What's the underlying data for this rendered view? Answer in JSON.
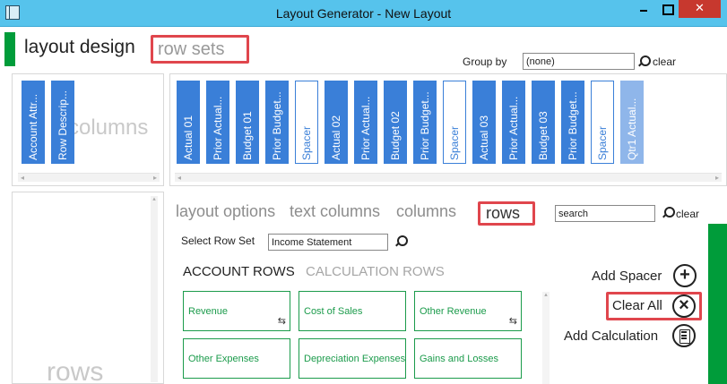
{
  "window": {
    "title": "Layout Generator - New Layout"
  },
  "header": {
    "layout_design": "layout design",
    "row_sets": "row sets"
  },
  "group_by": {
    "label": "Group by",
    "value": "(none)",
    "clear": "clear"
  },
  "columns_panel": {
    "ghost_text": "columns",
    "tiles": [
      {
        "label": "Account Attr...",
        "kind": "normal"
      },
      {
        "label": "Row Descrip...",
        "kind": "normal"
      }
    ]
  },
  "layout_panel": {
    "tiles": [
      {
        "label": "Actual 01",
        "kind": "normal"
      },
      {
        "label": "Prior Actual...",
        "kind": "normal"
      },
      {
        "label": "Budget 01",
        "kind": "normal"
      },
      {
        "label": "Prior Budget...",
        "kind": "normal"
      },
      {
        "label": "Spacer",
        "kind": "spacer"
      },
      {
        "label": "Actual 02",
        "kind": "normal"
      },
      {
        "label": "Prior Actual...",
        "kind": "normal"
      },
      {
        "label": "Budget 02",
        "kind": "normal"
      },
      {
        "label": "Prior Budget...",
        "kind": "normal"
      },
      {
        "label": "Spacer",
        "kind": "spacer"
      },
      {
        "label": "Actual 03",
        "kind": "normal"
      },
      {
        "label": "Prior Actual...",
        "kind": "normal"
      },
      {
        "label": "Budget 03",
        "kind": "normal"
      },
      {
        "label": "Prior Budget...",
        "kind": "normal"
      },
      {
        "label": "Spacer",
        "kind": "spacer"
      },
      {
        "label": "Qtr1 Actual...",
        "kind": "faded"
      }
    ]
  },
  "rows_panel": {
    "ghost_text": "rows"
  },
  "options_tabs": {
    "layout_options": "layout options",
    "text_columns": "text columns",
    "columns": "columns",
    "rows": "rows"
  },
  "search": {
    "value": "search",
    "clear": "clear"
  },
  "row_set": {
    "label": "Select Row Set",
    "value": "Income Statement"
  },
  "row_tabs": {
    "account_rows": "ACCOUNT ROWS",
    "calculation_rows": "CALCULATION ROWS"
  },
  "row_tiles": [
    {
      "label": "Revenue",
      "swap": true
    },
    {
      "label": "Cost of Sales",
      "swap": false
    },
    {
      "label": "Other Revenue",
      "swap": true
    },
    {
      "label": "Other Expenses",
      "swap": false
    },
    {
      "label": "Depreciation Expenses",
      "swap": false
    },
    {
      "label": "Gains and Losses",
      "swap": false
    }
  ],
  "actions": {
    "add_spacer": "Add Spacer",
    "clear_all": "Clear All",
    "add_calculation": "Add Calculation"
  },
  "icons": {
    "plus": "+",
    "times": "×",
    "swap": "⇆"
  }
}
